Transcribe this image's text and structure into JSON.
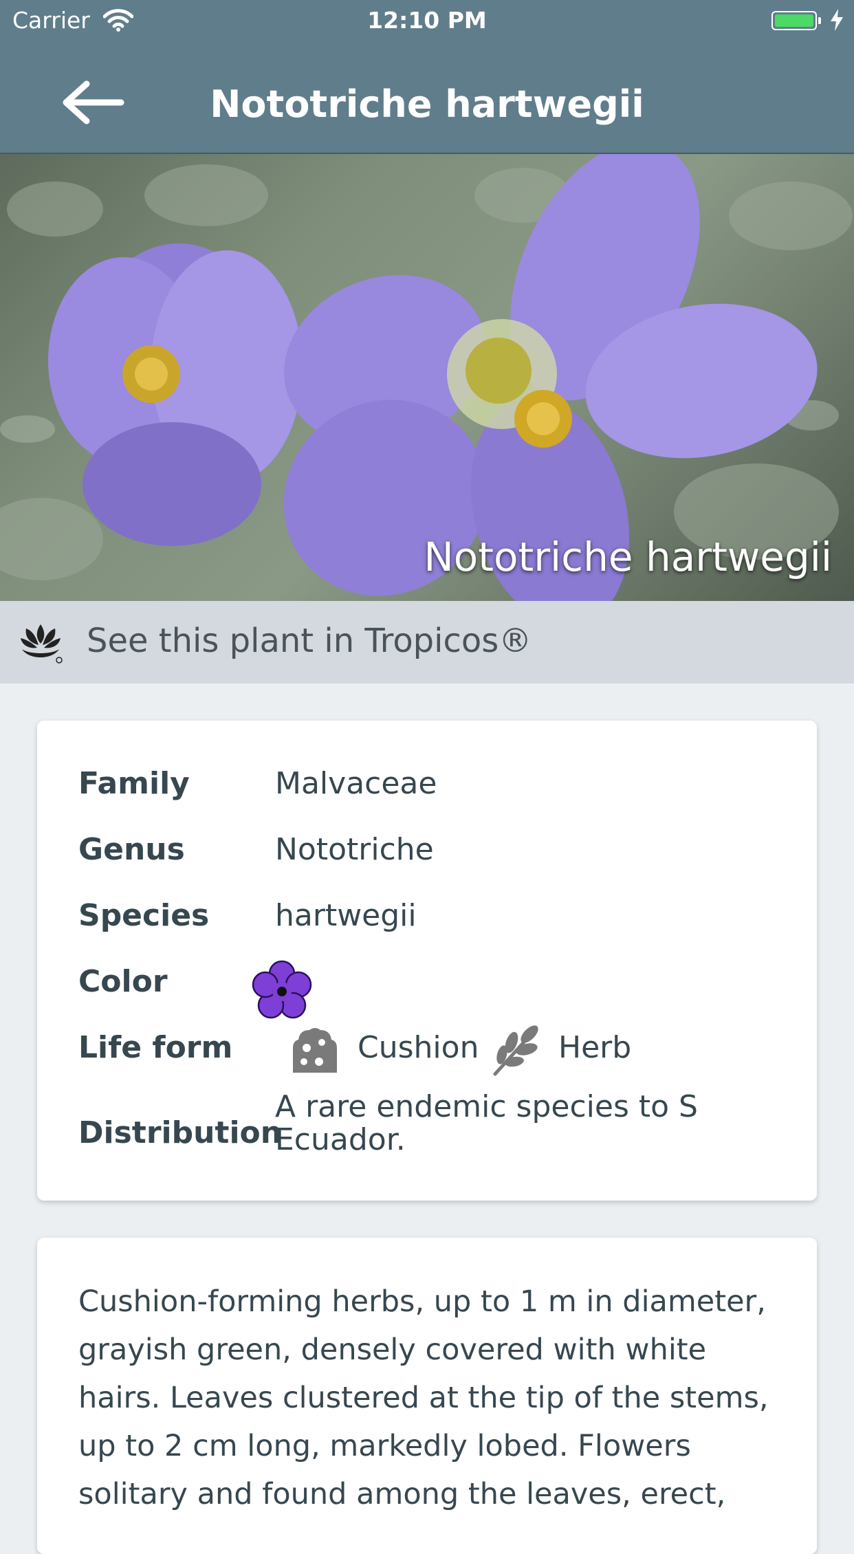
{
  "status_bar": {
    "carrier": "Carrier",
    "time": "12:10 PM"
  },
  "nav": {
    "title": "Nototriche hartwegii",
    "back_icon": "arrow-left-icon"
  },
  "hero": {
    "caption": "Nototriche hartwegii"
  },
  "tropicos": {
    "label": "See this plant in Tropicos®",
    "icon": "tropicos-logo-icon"
  },
  "details": {
    "family_label": "Family",
    "family_value": "Malvaceae",
    "genus_label": "Genus",
    "genus_value": "Nototriche",
    "species_label": "Species",
    "species_value": "hartwegii",
    "color_label": "Color",
    "color_value_color": "#7e3fd6",
    "life_form_label": "Life form",
    "life_forms": [
      {
        "label": "Cushion",
        "icon": "cushion-icon"
      },
      {
        "label": "Herb",
        "icon": "herb-icon"
      }
    ],
    "distribution_label": "Distribution",
    "distribution_value": "A rare endemic species to S Ecuador."
  },
  "description": "Cushion-forming herbs, up to 1 m in diameter, grayish green, densely covered with white hairs. Leaves clustered at the tip of the stems, up to 2 cm long, markedly lobed. Flowers solitary and found among the leaves, erect,",
  "colors": {
    "nav_bg": "#607d8b",
    "page_bg": "#eceff1",
    "tropicos_bg": "#d3d9de",
    "flower_purple": "#7e3fd6"
  }
}
